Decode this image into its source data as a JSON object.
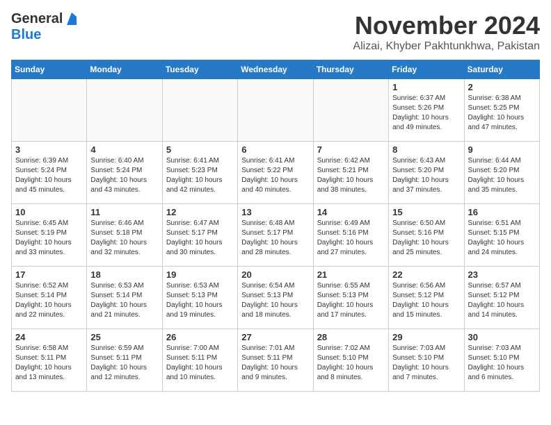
{
  "header": {
    "logo_general": "General",
    "logo_blue": "Blue",
    "title": "November 2024",
    "location": "Alizai, Khyber Pakhtunkhwa, Pakistan"
  },
  "days_of_week": [
    "Sunday",
    "Monday",
    "Tuesday",
    "Wednesday",
    "Thursday",
    "Friday",
    "Saturday"
  ],
  "weeks": [
    [
      {
        "day": "",
        "info": ""
      },
      {
        "day": "",
        "info": ""
      },
      {
        "day": "",
        "info": ""
      },
      {
        "day": "",
        "info": ""
      },
      {
        "day": "",
        "info": ""
      },
      {
        "day": "1",
        "info": "Sunrise: 6:37 AM\nSunset: 5:26 PM\nDaylight: 10 hours\nand 49 minutes."
      },
      {
        "day": "2",
        "info": "Sunrise: 6:38 AM\nSunset: 5:25 PM\nDaylight: 10 hours\nand 47 minutes."
      }
    ],
    [
      {
        "day": "3",
        "info": "Sunrise: 6:39 AM\nSunset: 5:24 PM\nDaylight: 10 hours\nand 45 minutes."
      },
      {
        "day": "4",
        "info": "Sunrise: 6:40 AM\nSunset: 5:24 PM\nDaylight: 10 hours\nand 43 minutes."
      },
      {
        "day": "5",
        "info": "Sunrise: 6:41 AM\nSunset: 5:23 PM\nDaylight: 10 hours\nand 42 minutes."
      },
      {
        "day": "6",
        "info": "Sunrise: 6:41 AM\nSunset: 5:22 PM\nDaylight: 10 hours\nand 40 minutes."
      },
      {
        "day": "7",
        "info": "Sunrise: 6:42 AM\nSunset: 5:21 PM\nDaylight: 10 hours\nand 38 minutes."
      },
      {
        "day": "8",
        "info": "Sunrise: 6:43 AM\nSunset: 5:20 PM\nDaylight: 10 hours\nand 37 minutes."
      },
      {
        "day": "9",
        "info": "Sunrise: 6:44 AM\nSunset: 5:20 PM\nDaylight: 10 hours\nand 35 minutes."
      }
    ],
    [
      {
        "day": "10",
        "info": "Sunrise: 6:45 AM\nSunset: 5:19 PM\nDaylight: 10 hours\nand 33 minutes."
      },
      {
        "day": "11",
        "info": "Sunrise: 6:46 AM\nSunset: 5:18 PM\nDaylight: 10 hours\nand 32 minutes."
      },
      {
        "day": "12",
        "info": "Sunrise: 6:47 AM\nSunset: 5:17 PM\nDaylight: 10 hours\nand 30 minutes."
      },
      {
        "day": "13",
        "info": "Sunrise: 6:48 AM\nSunset: 5:17 PM\nDaylight: 10 hours\nand 28 minutes."
      },
      {
        "day": "14",
        "info": "Sunrise: 6:49 AM\nSunset: 5:16 PM\nDaylight: 10 hours\nand 27 minutes."
      },
      {
        "day": "15",
        "info": "Sunrise: 6:50 AM\nSunset: 5:16 PM\nDaylight: 10 hours\nand 25 minutes."
      },
      {
        "day": "16",
        "info": "Sunrise: 6:51 AM\nSunset: 5:15 PM\nDaylight: 10 hours\nand 24 minutes."
      }
    ],
    [
      {
        "day": "17",
        "info": "Sunrise: 6:52 AM\nSunset: 5:14 PM\nDaylight: 10 hours\nand 22 minutes."
      },
      {
        "day": "18",
        "info": "Sunrise: 6:53 AM\nSunset: 5:14 PM\nDaylight: 10 hours\nand 21 minutes."
      },
      {
        "day": "19",
        "info": "Sunrise: 6:53 AM\nSunset: 5:13 PM\nDaylight: 10 hours\nand 19 minutes."
      },
      {
        "day": "20",
        "info": "Sunrise: 6:54 AM\nSunset: 5:13 PM\nDaylight: 10 hours\nand 18 minutes."
      },
      {
        "day": "21",
        "info": "Sunrise: 6:55 AM\nSunset: 5:13 PM\nDaylight: 10 hours\nand 17 minutes."
      },
      {
        "day": "22",
        "info": "Sunrise: 6:56 AM\nSunset: 5:12 PM\nDaylight: 10 hours\nand 15 minutes."
      },
      {
        "day": "23",
        "info": "Sunrise: 6:57 AM\nSunset: 5:12 PM\nDaylight: 10 hours\nand 14 minutes."
      }
    ],
    [
      {
        "day": "24",
        "info": "Sunrise: 6:58 AM\nSunset: 5:11 PM\nDaylight: 10 hours\nand 13 minutes."
      },
      {
        "day": "25",
        "info": "Sunrise: 6:59 AM\nSunset: 5:11 PM\nDaylight: 10 hours\nand 12 minutes."
      },
      {
        "day": "26",
        "info": "Sunrise: 7:00 AM\nSunset: 5:11 PM\nDaylight: 10 hours\nand 10 minutes."
      },
      {
        "day": "27",
        "info": "Sunrise: 7:01 AM\nSunset: 5:11 PM\nDaylight: 10 hours\nand 9 minutes."
      },
      {
        "day": "28",
        "info": "Sunrise: 7:02 AM\nSunset: 5:10 PM\nDaylight: 10 hours\nand 8 minutes."
      },
      {
        "day": "29",
        "info": "Sunrise: 7:03 AM\nSunset: 5:10 PM\nDaylight: 10 hours\nand 7 minutes."
      },
      {
        "day": "30",
        "info": "Sunrise: 7:03 AM\nSunset: 5:10 PM\nDaylight: 10 hours\nand 6 minutes."
      }
    ]
  ]
}
